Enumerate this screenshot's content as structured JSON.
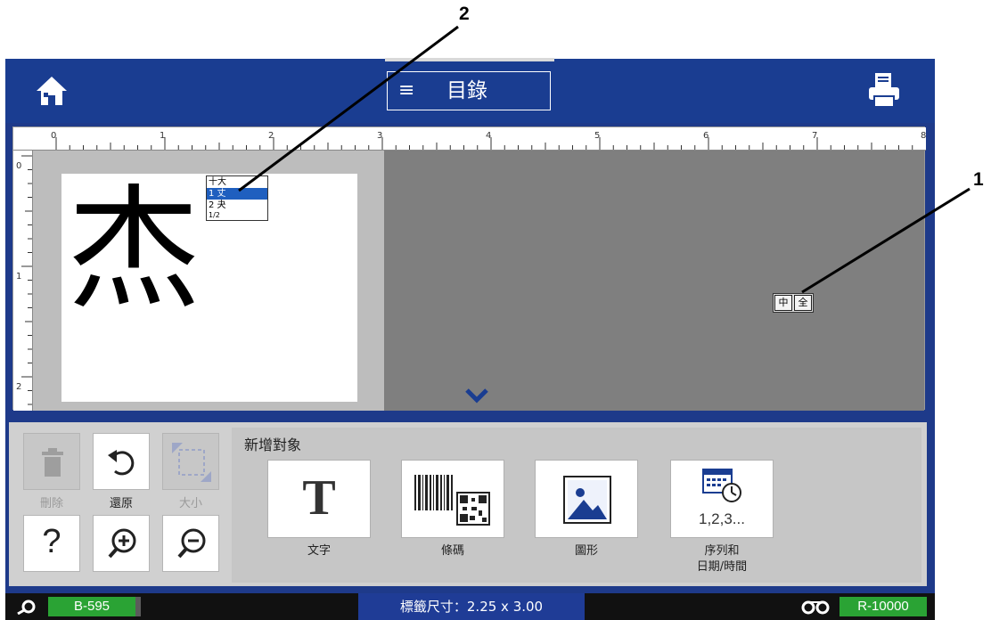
{
  "callouts": {
    "one": "1",
    "two": "2"
  },
  "header": {
    "menu_icon": "≡",
    "menu_label": "目錄"
  },
  "editor": {
    "ruler_numbers": [
      "0",
      "1",
      "2",
      "3",
      "4",
      "5",
      "6",
      "7",
      "8"
    ],
    "vertical_ruler_numbers": [
      "0",
      "1",
      "2"
    ],
    "label_char": "杰",
    "ime_candidates": [
      "十大",
      "1 丈",
      "2 夬",
      "1/2"
    ],
    "ime_toggle": [
      "中",
      "全"
    ]
  },
  "tools": {
    "delete_label": "刪除",
    "undo_label": "還原",
    "size_label": "大小",
    "help_glyph": "?"
  },
  "add_object": {
    "title": "新增對象",
    "text_glyph": "T",
    "text_label": "文字",
    "barcode_label": "條碼",
    "graphic_label": "圖形",
    "serial_glyph": "1,2,3...",
    "serial_label_line1": "序列和",
    "serial_label_line2": "日期/時間"
  },
  "status": {
    "left_value": "B-595",
    "center_text": "標籤尺寸：2.25 x 3.00",
    "right_value": "R-10000",
    "colors": {
      "green": "#2aa334",
      "blue": "#1f3c96"
    }
  }
}
